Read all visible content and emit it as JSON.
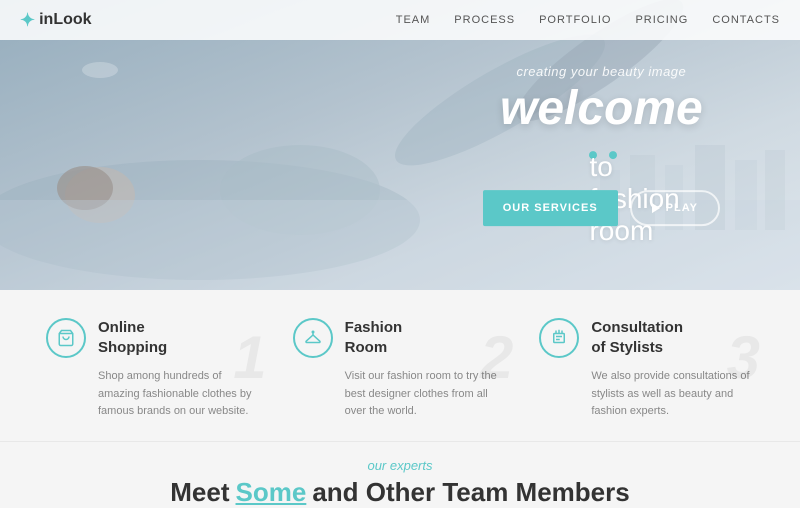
{
  "navbar": {
    "logo": "inLook",
    "links": [
      "TEAM",
      "PROCESS",
      "PORTFOLIO",
      "PRICING",
      "CONTACTS"
    ]
  },
  "hero": {
    "tagline": "creating your beauty image",
    "title": "welcome",
    "subtitle": "to fashion room",
    "btn_services": "OUR SERVICES",
    "btn_play": "PLAY"
  },
  "features": [
    {
      "number": "1",
      "title": "Online\nShopping",
      "icon": "bag",
      "text": "Shop among hundreds of amazing fashionable clothes by famous brands on our website."
    },
    {
      "number": "2",
      "title": "Fashion\nRoom",
      "icon": "hanger",
      "text": "Visit our fashion room to try the best designer clothes from all over the world."
    },
    {
      "number": "3",
      "title": "Consultation\nof Stylists",
      "icon": "people",
      "text": "We also provide consultations of stylists as well as beauty and fashion experts."
    }
  ],
  "experts": {
    "label": "our experts",
    "title_pre": "Meet ",
    "title_highlight": "Some",
    "title_post": " and Other Team Members"
  }
}
